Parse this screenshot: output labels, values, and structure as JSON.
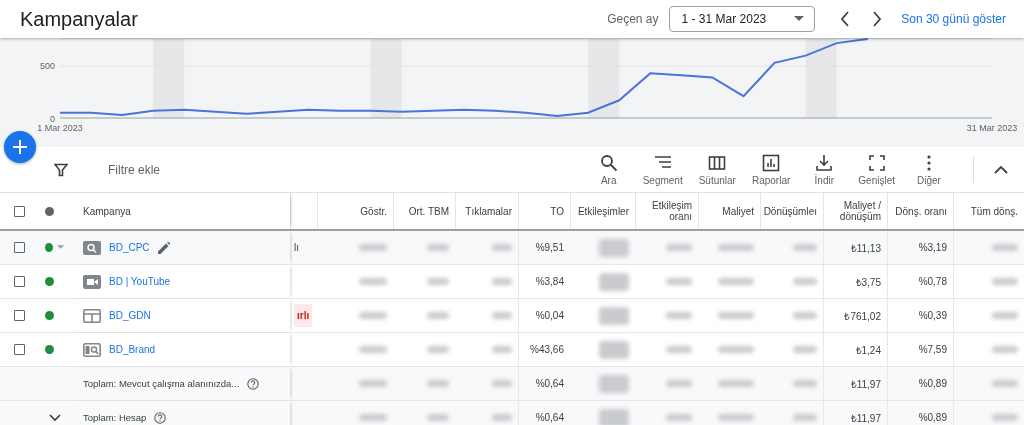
{
  "header": {
    "title": "Kampanyalar",
    "period_label": "Geçen ay",
    "date_range": "1 - 31 Mar 2023",
    "last_30_link": "Son 30 günü göster"
  },
  "chart_data": {
    "type": "line",
    "categories": [
      "1 Mar 2023",
      null,
      null,
      null,
      null,
      null,
      null,
      null,
      null,
      null,
      null,
      null,
      null,
      null,
      null,
      null,
      null,
      null,
      null,
      null,
      null,
      null,
      null,
      null,
      null,
      null,
      null,
      null,
      null,
      null,
      "31 Mar 2023"
    ],
    "series": [
      {
        "color": "#4a74d9",
        "values": [
          50,
          50,
          30,
          70,
          80,
          60,
          40,
          60,
          80,
          70,
          70,
          60,
          70,
          80,
          70,
          50,
          20,
          50,
          170,
          430,
          410,
          390,
          210,
          530,
          600,
          720,
          760,
          null,
          null,
          null,
          null
        ]
      }
    ],
    "ylim": [
      0,
      769
    ],
    "yticks": [
      0,
      500
    ]
  },
  "toolbar": {
    "filter_placeholder": "Filtre ekle",
    "tools": [
      {
        "kind": "search",
        "label": "Ara"
      },
      {
        "kind": "segment",
        "label": "Segment"
      },
      {
        "kind": "columns",
        "label": "Sütunlar"
      },
      {
        "kind": "reports",
        "label": "Raporlar"
      },
      {
        "kind": "download",
        "label": "İndir"
      },
      {
        "kind": "expand",
        "label": "Genişlet"
      },
      {
        "kind": "more",
        "label": "Diğer"
      }
    ]
  },
  "table": {
    "name_column": "Kampanya",
    "columns": [
      "Göstr.",
      "Ort. TBM",
      "Tıklamalar",
      "TO",
      "Etkileşimler",
      "Etkileşim oranı",
      "Maliyet",
      "Dönüşümleı",
      "Maliyet / dönüşüm",
      "Dönş. oranı",
      "Tüm dönş."
    ],
    "all_checked": false,
    "rows": [
      {
        "kind": "search",
        "name": "BD_CPC",
        "color": "#1e8e3e",
        "checked": false,
        "hovered": true,
        "status": "lı",
        "status_alert": false,
        "cells": [
          {
            "blurred": true
          },
          {
            "blurred": true
          },
          {
            "blurred": true
          },
          {
            "text": "%9,51"
          },
          {
            "blurred": true
          },
          {
            "blurred": true
          },
          {
            "blurred": true
          },
          {
            "blurred": true
          },
          {
            "text": "₺11,13"
          },
          {
            "text": "%3,19"
          },
          {
            "blurred": true
          }
        ]
      },
      {
        "kind": "video",
        "name": "BD | YouTube",
        "color": "#1e8e3e",
        "checked": false,
        "hovered": false,
        "cells": [
          {
            "blurred": true
          },
          {
            "blurred": true
          },
          {
            "blurred": true
          },
          {
            "text": "%3,84"
          },
          {
            "blurred": true
          },
          {
            "blurred": true
          },
          {
            "blurred": true
          },
          {
            "blurred": true
          },
          {
            "text": "₺3,75"
          },
          {
            "text": "%0,78"
          },
          {
            "blurred": true
          }
        ]
      },
      {
        "kind": "display",
        "name": "BD_GDN",
        "color": "#1e8e3e",
        "checked": false,
        "hovered": false,
        "status": "ırlı",
        "status_alert": true,
        "cells": [
          {
            "blurred": true
          },
          {
            "blurred": true
          },
          {
            "blurred": true
          },
          {
            "text": "%0,04"
          },
          {
            "blurred": true
          },
          {
            "blurred": true
          },
          {
            "blurred": true
          },
          {
            "blurred": true
          },
          {
            "text": "₺761,02"
          },
          {
            "text": "%0,39"
          },
          {
            "blurred": true
          }
        ]
      },
      {
        "kind": "brand",
        "name": "BD_Brand",
        "color": "#1e8e3e",
        "checked": false,
        "hovered": false,
        "cells": [
          {
            "blurred": true
          },
          {
            "blurred": true
          },
          {
            "blurred": true
          },
          {
            "text": "%43,66"
          },
          {
            "blurred": true
          },
          {
            "blurred": true
          },
          {
            "blurred": true
          },
          {
            "blurred": true
          },
          {
            "text": "₺1,24"
          },
          {
            "text": "%7,59"
          },
          {
            "blurred": true
          }
        ]
      },
      {
        "kind": "total",
        "name": "Toplam: Mevcut çalışma alanınızda...",
        "expandable": false,
        "cells": [
          {
            "blurred": true
          },
          {
            "blurred": true
          },
          {
            "blurred": true
          },
          {
            "text": "%0,64"
          },
          {
            "blurred": true
          },
          {
            "blurred": true
          },
          {
            "blurred": true
          },
          {
            "blurred": true
          },
          {
            "text": "₺11,97"
          },
          {
            "text": "%0,89"
          },
          {
            "blurred": true
          }
        ]
      },
      {
        "kind": "total",
        "name": "Toplam: Hesap",
        "expandable": true,
        "cells": [
          {
            "blurred": true
          },
          {
            "blurred": true
          },
          {
            "blurred": true
          },
          {
            "text": "%0,64"
          },
          {
            "blurred": true
          },
          {
            "blurred": true
          },
          {
            "blurred": true
          },
          {
            "blurred": true
          },
          {
            "text": "₺11,97"
          },
          {
            "text": "%0,89"
          },
          {
            "blurred": true
          }
        ]
      }
    ]
  }
}
